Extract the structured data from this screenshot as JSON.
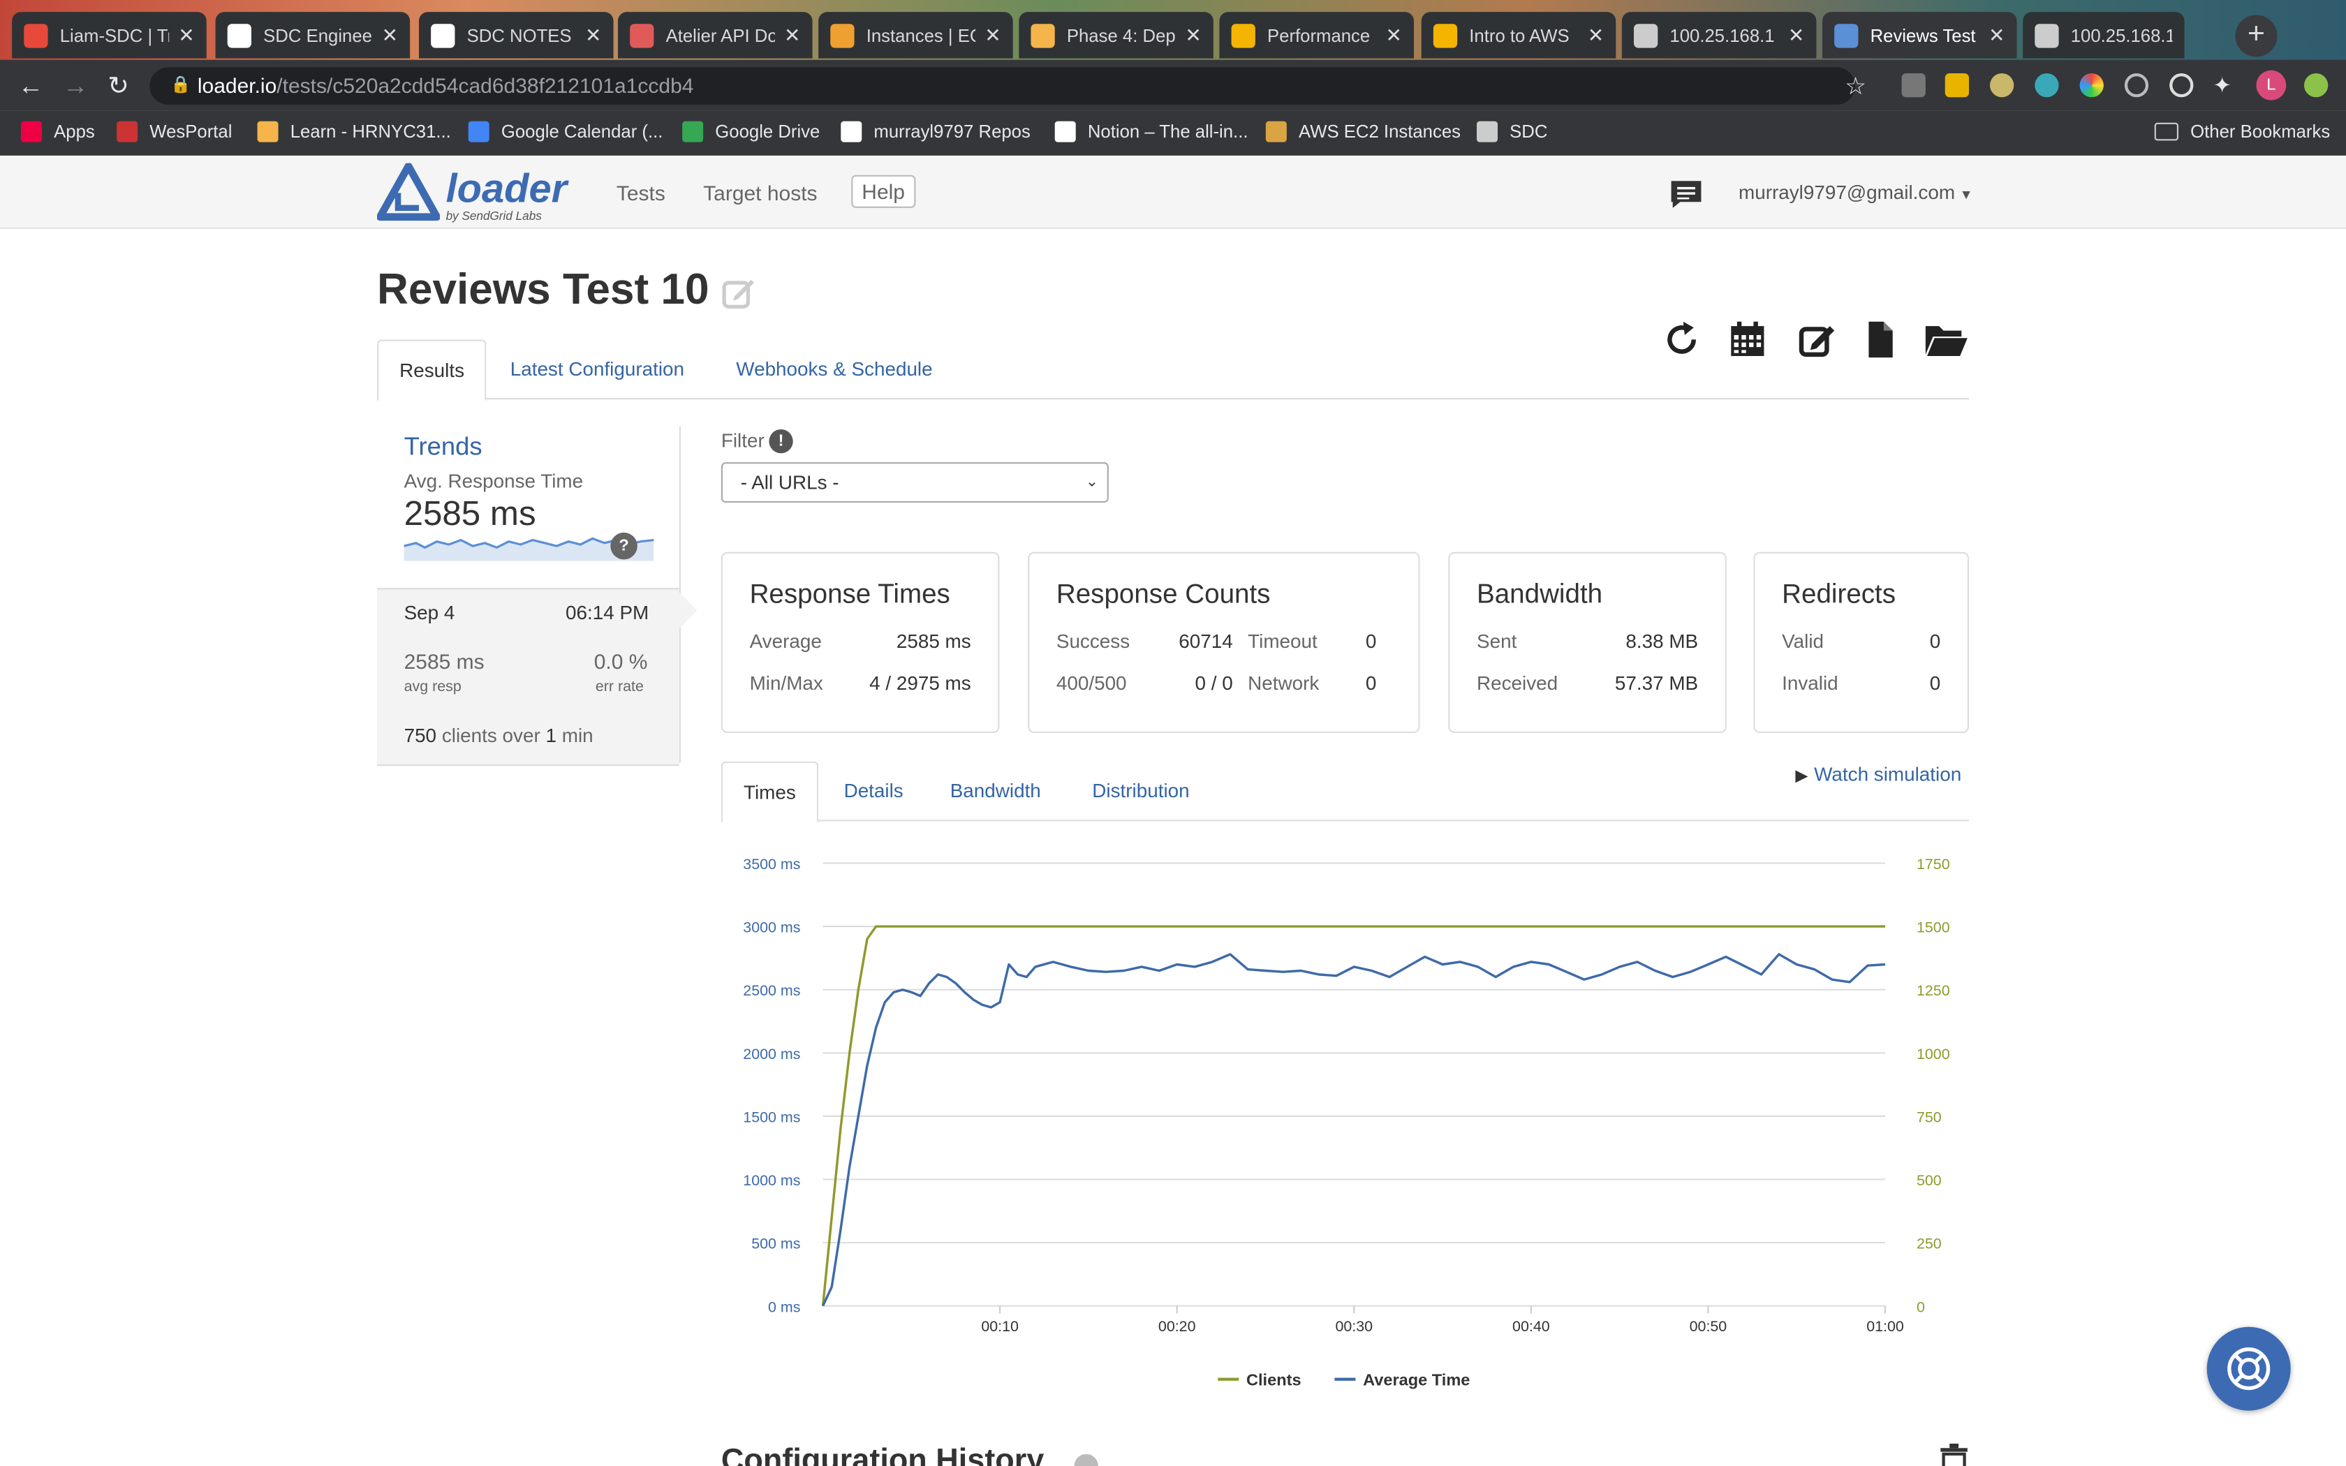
{
  "browser": {
    "tabs": [
      {
        "title": "Liam-SDC | Tr",
        "icon": "trello-icon",
        "color": "#e8493a"
      },
      {
        "title": "SDC Enginee",
        "icon": "github-icon",
        "color": "#ffffff"
      },
      {
        "title": "SDC NOTES",
        "icon": "notion-icon",
        "color": "#ffffff"
      },
      {
        "title": "Atelier API Do",
        "icon": "api-doc-icon",
        "color": "#e05a5a"
      },
      {
        "title": "Instances | EC",
        "icon": "aws-icon",
        "color": "#f0a030"
      },
      {
        "title": "Phase 4: Depl",
        "icon": "hackreactor-icon",
        "color": "#f5b54a"
      },
      {
        "title": "Performance",
        "icon": "slides-icon",
        "color": "#f4b400"
      },
      {
        "title": "Intro to AWS",
        "icon": "slides-icon",
        "color": "#f4b400"
      },
      {
        "title": "100.25.168.1",
        "icon": "globe-icon",
        "color": "#cccccc"
      },
      {
        "title": "Reviews Test",
        "icon": "loader-icon",
        "color": "#5b8fd6"
      },
      {
        "title": "100.25.168.1",
        "icon": "globe-icon",
        "color": "#cccccc"
      }
    ],
    "active_tab": 9,
    "url_host": "loader.io",
    "url_path": "/tests/c520a2cdd54cad6d38f212101a1ccdb4",
    "bookmarks": [
      {
        "label": "Apps",
        "icon": "apps-grid-icon"
      },
      {
        "label": "WesPortal",
        "icon": "wesleyan-icon"
      },
      {
        "label": "Learn - HRNYC31...",
        "icon": "hackreactor-icon"
      },
      {
        "label": "Google Calendar (...",
        "icon": "calendar-icon"
      },
      {
        "label": "Google Drive",
        "icon": "drive-icon"
      },
      {
        "label": "murrayl9797 Repos",
        "icon": "github-icon"
      },
      {
        "label": "Notion – The all-in...",
        "icon": "notion-icon"
      },
      {
        "label": "AWS EC2 Instances",
        "icon": "aws-box-icon"
      },
      {
        "label": "SDC",
        "icon": "folder-icon"
      }
    ],
    "other_bookmarks": "Other Bookmarks",
    "profile_initial": "L"
  },
  "header": {
    "logo": "loader",
    "logo_sub": "by SendGrid Labs",
    "nav": [
      "Tests",
      "Target hosts",
      "Help"
    ],
    "user_email": "murrayl9797@gmail.com"
  },
  "page": {
    "title": "Reviews Test 10",
    "tabs": [
      "Results",
      "Latest Configuration",
      "Webhooks & Schedule"
    ],
    "active_tab": 0
  },
  "trends": {
    "heading": "Trends",
    "metric_label": "Avg. Response Time",
    "metric_value": "2585 ms",
    "help": "?",
    "run": {
      "date": "Sep 4",
      "time": "06:14 PM",
      "avg_resp": "2585 ms",
      "avg_resp_label": "avg resp",
      "err_rate": "0.0 %",
      "err_rate_label": "err rate",
      "clients": "750",
      "clients_mid": "clients over",
      "duration": "1",
      "duration_unit": "min"
    }
  },
  "filter": {
    "label": "Filter",
    "info": "!",
    "selected": "- All URLs -"
  },
  "cards": {
    "response_times": {
      "title": "Response Times",
      "average_label": "Average",
      "average": "2585 ms",
      "minmax_label": "Min/Max",
      "minmax": "4 / 2975 ms"
    },
    "response_counts": {
      "title": "Response Counts",
      "success_label": "Success",
      "success": "60714",
      "timeout_label": "Timeout",
      "timeout": "0",
      "err_label": "400/500",
      "err": "0 / 0",
      "network_label": "Network",
      "network": "0"
    },
    "bandwidth": {
      "title": "Bandwidth",
      "sent_label": "Sent",
      "sent": "8.38 MB",
      "received_label": "Received",
      "received": "57.37 MB"
    },
    "redirects": {
      "title": "Redirects",
      "valid_label": "Valid",
      "valid": "0",
      "invalid_label": "Invalid",
      "invalid": "0"
    }
  },
  "chart_tabs": [
    "Times",
    "Details",
    "Bandwidth",
    "Distribution"
  ],
  "watch_simulation": "Watch simulation",
  "colors": {
    "clients": "#8f9a2c",
    "average_time": "#3e6aa8",
    "link": "#3465a4"
  },
  "chart_data": {
    "type": "line",
    "x_ticks": [
      "00:10",
      "00:20",
      "00:30",
      "00:40",
      "00:50",
      "01:00"
    ],
    "xlim": [
      0,
      60
    ],
    "y_left_ticks": [
      "0 ms",
      "500 ms",
      "1000 ms",
      "1500 ms",
      "2000 ms",
      "2500 ms",
      "3000 ms",
      "3500 ms"
    ],
    "ylim_left": [
      0,
      3500
    ],
    "y_right_ticks": [
      "0",
      "250",
      "500",
      "750",
      "1000",
      "1250",
      "1500",
      "1750"
    ],
    "ylim_right": [
      0,
      1750
    ],
    "grid": true,
    "legend": "bottom-center",
    "series": [
      {
        "name": "Clients",
        "axis": "right",
        "x": [
          0,
          0.5,
          1,
          1.5,
          2,
          2.5,
          3,
          10,
          20,
          30,
          40,
          50,
          60
        ],
        "values": [
          0,
          350,
          700,
          1000,
          1250,
          1450,
          1500,
          1500,
          1500,
          1500,
          1500,
          1500,
          1500
        ]
      },
      {
        "name": "Average Time",
        "axis": "left",
        "x": [
          0,
          0.5,
          1,
          1.5,
          2,
          2.5,
          3,
          3.5,
          4,
          4.5,
          5,
          5.5,
          6,
          6.5,
          7,
          7.5,
          8,
          8.5,
          9,
          9.5,
          10,
          10.5,
          11,
          11.5,
          12,
          13,
          14,
          15,
          16,
          17,
          18,
          19,
          20,
          21,
          22,
          23,
          24,
          25,
          26,
          27,
          28,
          29,
          30,
          31,
          32,
          33,
          34,
          35,
          36,
          37,
          38,
          39,
          40,
          41,
          42,
          43,
          44,
          45,
          46,
          47,
          48,
          49,
          50,
          51,
          52,
          53,
          54,
          55,
          56,
          57,
          58,
          59,
          60
        ],
        "values": [
          0,
          150,
          600,
          1100,
          1500,
          1900,
          2200,
          2400,
          2480,
          2500,
          2480,
          2450,
          2550,
          2620,
          2600,
          2550,
          2480,
          2420,
          2380,
          2360,
          2400,
          2700,
          2620,
          2600,
          2680,
          2720,
          2680,
          2650,
          2640,
          2650,
          2680,
          2650,
          2700,
          2680,
          2720,
          2780,
          2660,
          2650,
          2640,
          2650,
          2620,
          2610,
          2680,
          2650,
          2600,
          2680,
          2760,
          2700,
          2720,
          2680,
          2600,
          2680,
          2720,
          2700,
          2640,
          2580,
          2620,
          2680,
          2720,
          2650,
          2600,
          2640,
          2700,
          2760,
          2690,
          2620,
          2780,
          2700,
          2660,
          2580,
          2560,
          2690,
          2700
        ]
      }
    ]
  },
  "config_history": "Configuration History"
}
